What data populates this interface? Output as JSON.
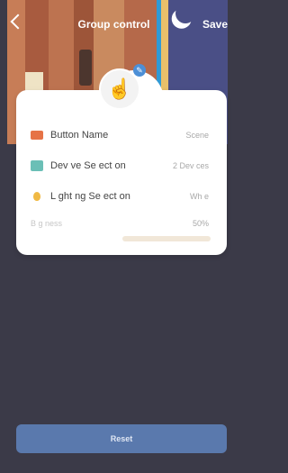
{
  "header": {
    "title": "Group control",
    "save_label": "Save"
  },
  "settings": [
    {
      "label": "Button Name",
      "value": "Scene"
    },
    {
      "label": "Dev ve Se ect on",
      "value": "2 Dev ces"
    },
    {
      "label": "L ght ng Se ect on",
      "value": "Wh e"
    }
  ],
  "brightness": {
    "label": "B g  ness",
    "value": "50%"
  },
  "footer": {
    "reset_label": "Reset"
  },
  "colors": {
    "background": "#3b3a48",
    "card": "#ffffff",
    "accent_button": "#5a79ad",
    "icon_button": "#e67346",
    "icon_device": "#6bbfb6",
    "icon_light": "#f0b944"
  },
  "icons": {
    "back": "back-arrow-icon",
    "moon": "moon-icon",
    "avatar": "touch-hand-icon",
    "edit": "pencil-icon"
  }
}
